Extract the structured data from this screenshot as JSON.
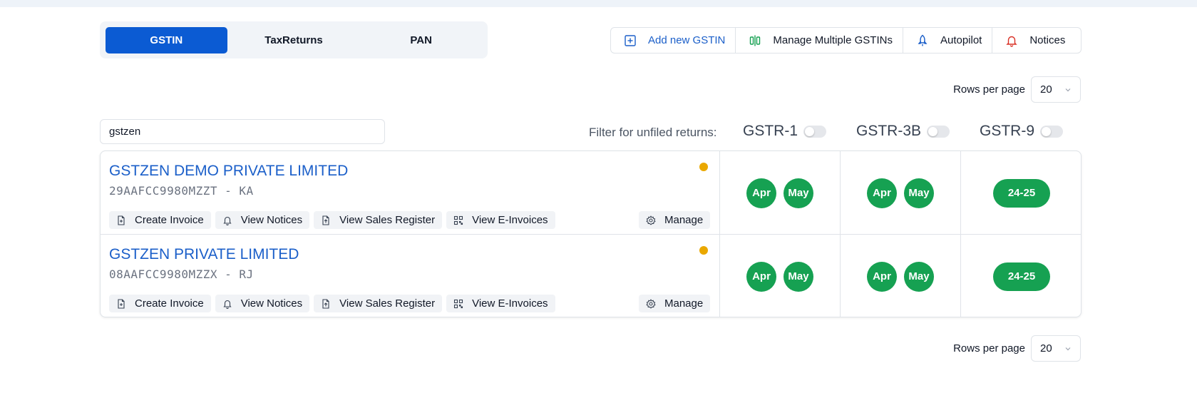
{
  "tabs": [
    {
      "label": "GSTIN",
      "active": true
    },
    {
      "label": "TaxReturns",
      "active": false
    },
    {
      "label": "PAN",
      "active": false
    }
  ],
  "actions": {
    "add_gstin": "Add new GSTIN",
    "manage_multiple": "Manage Multiple GSTINs",
    "autopilot": "Autopilot",
    "notices": "Notices"
  },
  "rows_per_page": {
    "label": "Rows per page",
    "value": "20"
  },
  "search": {
    "value": "gstzen"
  },
  "filter": {
    "label": "Filter for unfiled returns:",
    "gstr1": "GSTR-1",
    "gstr3b": "GSTR-3B",
    "gstr9": "GSTR-9"
  },
  "row_buttons": {
    "create_invoice": "Create Invoice",
    "view_notices": "View Notices",
    "view_sales_register": "View Sales Register",
    "view_einvoices": "View E-Invoices",
    "manage": "Manage"
  },
  "rows": [
    {
      "name": "GSTZEN DEMO PRIVATE LIMITED",
      "gstin": "29AAFCC9980MZZT - KA",
      "gstr1": [
        "Apr",
        "May"
      ],
      "gstr3b": [
        "Apr",
        "May"
      ],
      "gstr9": "24-25"
    },
    {
      "name": "GSTZEN PRIVATE LIMITED",
      "gstin": "08AAFCC9980MZZX - RJ",
      "gstr1": [
        "Apr",
        "May"
      ],
      "gstr3b": [
        "Apr",
        "May"
      ],
      "gstr9": "24-25"
    }
  ],
  "colors": {
    "primary": "#0b5bd3",
    "filed_green": "#16a152",
    "status_dot": "#eaa800"
  }
}
